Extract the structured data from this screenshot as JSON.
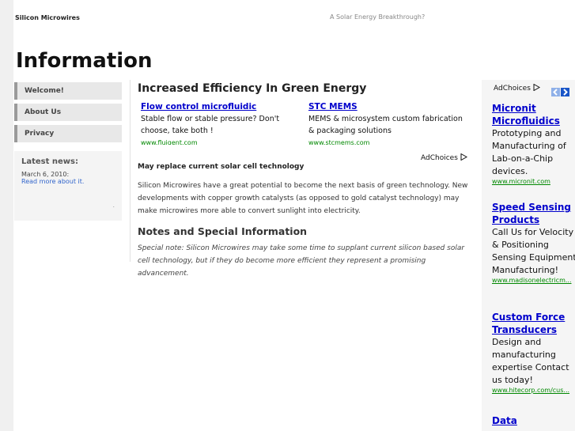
{
  "header": {
    "site_name": "Silicon Microwires",
    "tagline": "A Solar Energy Breakthrough?",
    "page_title": "Information"
  },
  "sidebar": {
    "items": [
      {
        "label": "Welcome!"
      },
      {
        "label": "About Us"
      },
      {
        "label": "Privacy"
      }
    ],
    "news": {
      "title": "Latest news:",
      "date": "March 6, 2010:",
      "link": "Read more about it.",
      "dot": "."
    }
  },
  "main": {
    "heading": "Increased Efficiency In Green Energy",
    "ads": [
      {
        "title": "Flow control microfluidic",
        "desc": "Stable flow or stable pressure? Don't choose, take both !",
        "url": "www.fluigent.com"
      },
      {
        "title": "STC MEMS",
        "desc": "MEMS & microsystem custom fabrication & packaging solutions",
        "url": "www.stcmems.com"
      }
    ],
    "adchoices": "AdChoices",
    "subheading": "May replace current solar cell technology",
    "paragraph": "Silicon Microwires have a great potential to become the next basis of green technology. New developments with copper growth catalysts (as opposed to gold catalyst technology) may make microwires more able to convert sunlight into electricity.",
    "notes_heading": "Notes and Special Information",
    "note": "Special note: Silicon Microwires may take some time to supplant current silicon based solar cell technology, but if they do become more efficient they represent a promising advancement."
  },
  "right_ads": {
    "adchoices": "AdChoices",
    "prev_icon": "chevron-left",
    "next_icon": "chevron-right",
    "items": [
      {
        "title": "Micronit Microfluidics",
        "desc": "Prototyping and Manufacturing of Lab-on-a-Chip devices.",
        "url": "www.micronit.com"
      },
      {
        "title": "Speed Sensing Products",
        "desc": "Call Us for Velocity & Positioning Sensing Equipment Manufacturing!",
        "url": "www.madisonelectricm..."
      },
      {
        "title": "Custom Force Transducers",
        "desc": "Design and manufacturing expertise Contact us today!",
        "url": "www.hitecorp.com/cus..."
      },
      {
        "title": "Data",
        "desc": "",
        "url": ""
      }
    ]
  },
  "colors": {
    "link": "#0000cc",
    "ad_url": "#008000",
    "nav_bg": "#e8e8e8",
    "nav_accent": "#9a9a9a",
    "arrow_blue": "#1a56c8",
    "arrow_light": "#8fb0e8"
  }
}
